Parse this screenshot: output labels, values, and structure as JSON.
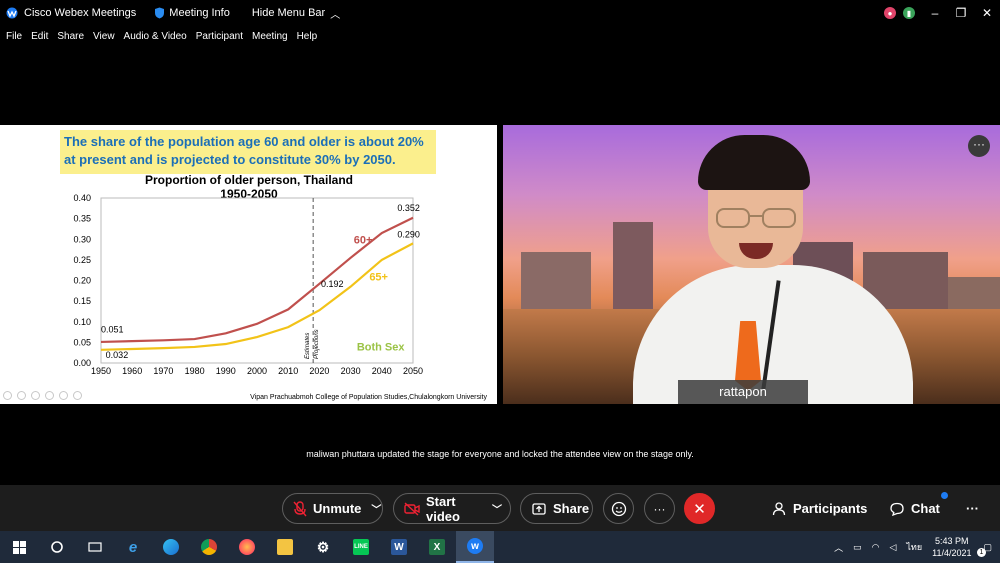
{
  "titlebar": {
    "app_title": "Cisco Webex Meetings",
    "meeting_info": "Meeting Info",
    "hide_menu": "Hide Menu Bar",
    "win_minimize": "–",
    "win_restore": "❐",
    "win_close": "✕"
  },
  "menubar": {
    "items": [
      "File",
      "Edit",
      "Share",
      "View",
      "Audio & Video",
      "Participant",
      "Meeting",
      "Help"
    ]
  },
  "slide": {
    "banner_line1": "The share of the population age 60 and older is about 20%",
    "banner_line2": "at present and is projected to constitute 30% by 2050.",
    "footer_credit": "Vipan Prachuabmoh College of Population Studies,Chulalongkorn University"
  },
  "chart_data": {
    "type": "line",
    "title": "Proportion of older person, Thailand",
    "subtitle": "1950-2050",
    "x": [
      1950,
      1960,
      1970,
      1980,
      1990,
      2000,
      2010,
      2020,
      2030,
      2040,
      2050
    ],
    "xlim": [
      1950,
      2050
    ],
    "ylim": [
      0,
      0.4
    ],
    "yticks": [
      "0.00",
      "0.05",
      "0.10",
      "0.15",
      "0.20",
      "0.25",
      "0.30",
      "0.35",
      "0.40"
    ],
    "xticks": [
      "1950",
      "1960",
      "1970",
      "1980",
      "1990",
      "2000",
      "2010",
      "2020",
      "2030",
      "2040",
      "2050"
    ],
    "series": [
      {
        "name": "60+",
        "color": "#c0504d",
        "values": [
          0.051,
          0.053,
          0.055,
          0.058,
          0.072,
          0.095,
          0.13,
          0.192,
          0.255,
          0.315,
          0.352
        ]
      },
      {
        "name": "65+",
        "color": "#f2c318",
        "values": [
          0.032,
          0.034,
          0.036,
          0.039,
          0.046,
          0.063,
          0.087,
          0.128,
          0.185,
          0.25,
          0.29
        ]
      }
    ],
    "annotations": [
      "0.051",
      "0.032",
      "0.192",
      "0.352",
      "0.290",
      "Both Sex"
    ],
    "divider_x": 2018,
    "divider_labels": [
      "Estimates",
      "Projections"
    ]
  },
  "video": {
    "participant_name": "rattapon",
    "more_label": "···"
  },
  "notice": "maliwan phuttara updated the stage for everyone and locked the attendee view on the stage only.",
  "controls": {
    "unmute": "Unmute",
    "start_video": "Start video",
    "share": "Share",
    "more": "···",
    "end": "✕",
    "participants": "Participants",
    "chat": "Chat",
    "overflow": "···"
  },
  "taskbar": {
    "lang": "ไทย",
    "time": "5:43 PM",
    "date": "11/4/2021",
    "notif_count": "1"
  },
  "colors": {
    "end_red": "#e02828",
    "banner_yellow": "#fbef8d",
    "banner_text": "#1b6fb8",
    "chat_badge": "#1e7cf3"
  }
}
